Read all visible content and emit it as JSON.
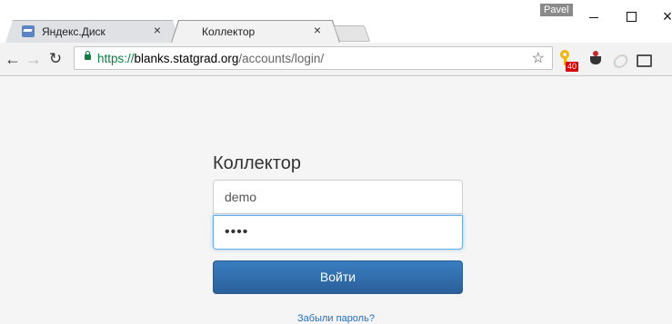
{
  "browser": {
    "tabs": [
      {
        "title": "Яндекс.Диск",
        "active": false,
        "icon": "yandex-disk-icon"
      },
      {
        "title": "Коллектор",
        "active": true,
        "icon": "blank-page-icon"
      }
    ],
    "profile_name": "Pavel",
    "url": {
      "protocol": "https://",
      "host": "blanks.statgrad.org",
      "path": "/accounts/login/"
    },
    "extension_badge": "40",
    "close_glyph": "×",
    "icons": [
      "back-arrow-icon",
      "forward-arrow-icon",
      "reload-icon",
      "lock-icon",
      "bookmark-star-icon",
      "key-extension-icon",
      "coffee-extension-icon",
      "gray-extension-icon",
      "cast-icon"
    ]
  },
  "login": {
    "title": "Коллектор",
    "username": "demo",
    "password_mask": "••••",
    "submit_label": "Войти",
    "forgot_link": "Забыли пароль?"
  },
  "colors": {
    "accent": "#2a6eb8",
    "button": "#2f6aa8",
    "secure_url": "#0b8043",
    "badge": "#d50000"
  }
}
